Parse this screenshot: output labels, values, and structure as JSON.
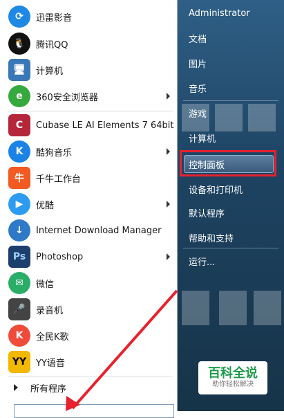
{
  "left_menu": {
    "items": [
      {
        "label": "迅雷影音",
        "icon": "xunlei-icon",
        "color": "#1e88e5",
        "has_arrow": false
      },
      {
        "label": "腾讯QQ",
        "icon": "qq-penguin-icon",
        "color": "#111111",
        "has_arrow": false
      },
      {
        "label": "计算机",
        "icon": "computer-icon",
        "color": "#3a77b6",
        "has_arrow": false
      },
      {
        "label": "360安全浏览器",
        "icon": "360-browser-icon",
        "color": "#36a93e",
        "has_arrow": true
      },
      {
        "label": "Cubase LE AI Elements 7 64bit",
        "icon": "cubase-icon",
        "color": "#b5263a",
        "has_arrow": false
      },
      {
        "label": "酷狗音乐",
        "icon": "kugou-icon",
        "color": "#1b83e6",
        "has_arrow": true
      },
      {
        "label": "千牛工作台",
        "icon": "qianniu-icon",
        "color": "#f15a22",
        "has_arrow": false
      },
      {
        "label": "优酷",
        "icon": "youku-icon",
        "color": "#2d9cf0",
        "has_arrow": true
      },
      {
        "label": "Internet Download Manager",
        "icon": "idm-icon",
        "color": "#2f7ac8",
        "has_arrow": false
      },
      {
        "label": "Photoshop",
        "icon": "photoshop-icon",
        "color": "#1c3f6e",
        "has_arrow": true
      },
      {
        "label": "微信",
        "icon": "wechat-icon",
        "color": "#2aae67",
        "has_arrow": false
      },
      {
        "label": "录音机",
        "icon": "microphone-icon",
        "color": "#444444",
        "has_arrow": false
      },
      {
        "label": "全民K歌",
        "icon": "kge-icon",
        "color": "#f04a3a",
        "has_arrow": false
      },
      {
        "label": "YY语音",
        "icon": "yy-icon",
        "color": "#f3b800",
        "has_arrow": false
      }
    ],
    "ico_text": [
      "⟳",
      "🐧",
      "🖥",
      "e",
      "C",
      "K",
      "牛",
      "▶",
      "↓",
      "Ps",
      "✉",
      "🎤",
      "K",
      "YY"
    ],
    "all_programs": "所有程序"
  },
  "right_menu": {
    "user": "Administrator",
    "links": [
      "文档",
      "图片",
      "音乐",
      "游戏",
      "计算机",
      "控制面板",
      "设备和打印机",
      "默认程序",
      "帮助和支持",
      "运行..."
    ]
  },
  "watermark": {
    "title": "百科全说",
    "subtitle": "助你轻松解决"
  },
  "colors": {
    "highlight": "#e8212c",
    "annotation_arrow": "#e8212c"
  }
}
